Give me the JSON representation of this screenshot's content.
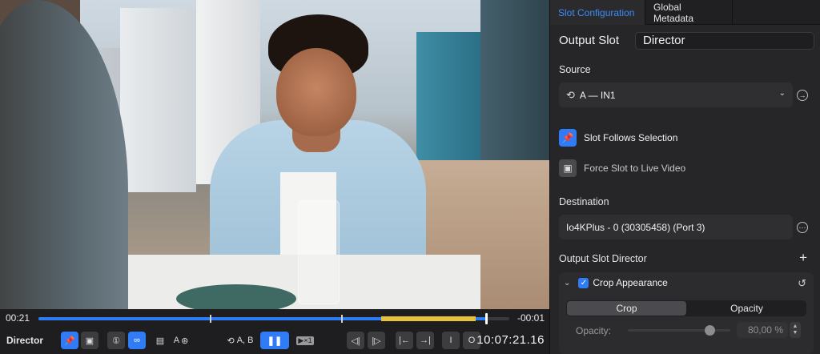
{
  "viewer": {
    "elapsed": "00:21",
    "remaining": "-00:01",
    "progress_fraction": 0.95
  },
  "controls": {
    "slot_label": "Director",
    "source_label": "A",
    "sources_label": "A, B",
    "rate_label": "×1",
    "in_label": "I",
    "out_label": "O",
    "timecode": "10:07:21.16"
  },
  "panel": {
    "tabs": [
      {
        "label": "Slot Configuration",
        "active": true
      },
      {
        "label": "Global Metadata",
        "active": false
      }
    ],
    "output_slot_label": "Output Slot",
    "output_slot_value": "Director",
    "source_section": "Source",
    "source_value": "A — IN1",
    "follow_selection_label": "Slot Follows Selection",
    "force_live_label": "Force Slot to Live Video",
    "destination_section": "Destination",
    "destination_value": "Io4KPlus - 0 (30305458) (Port 3)",
    "output_slot_director_label": "Output Slot Director",
    "crop": {
      "title": "Crop Appearance",
      "checked": true,
      "segments": [
        "Crop",
        "Opacity"
      ],
      "selected_segment": "Crop",
      "opacity_label": "Opacity:",
      "opacity_value": "80,00 %",
      "opacity_fraction": 0.8
    }
  },
  "colors": {
    "accent": "#2f7cf6",
    "tab_active": "#3b8cf7",
    "marker_yellow": "#e8c23a"
  }
}
